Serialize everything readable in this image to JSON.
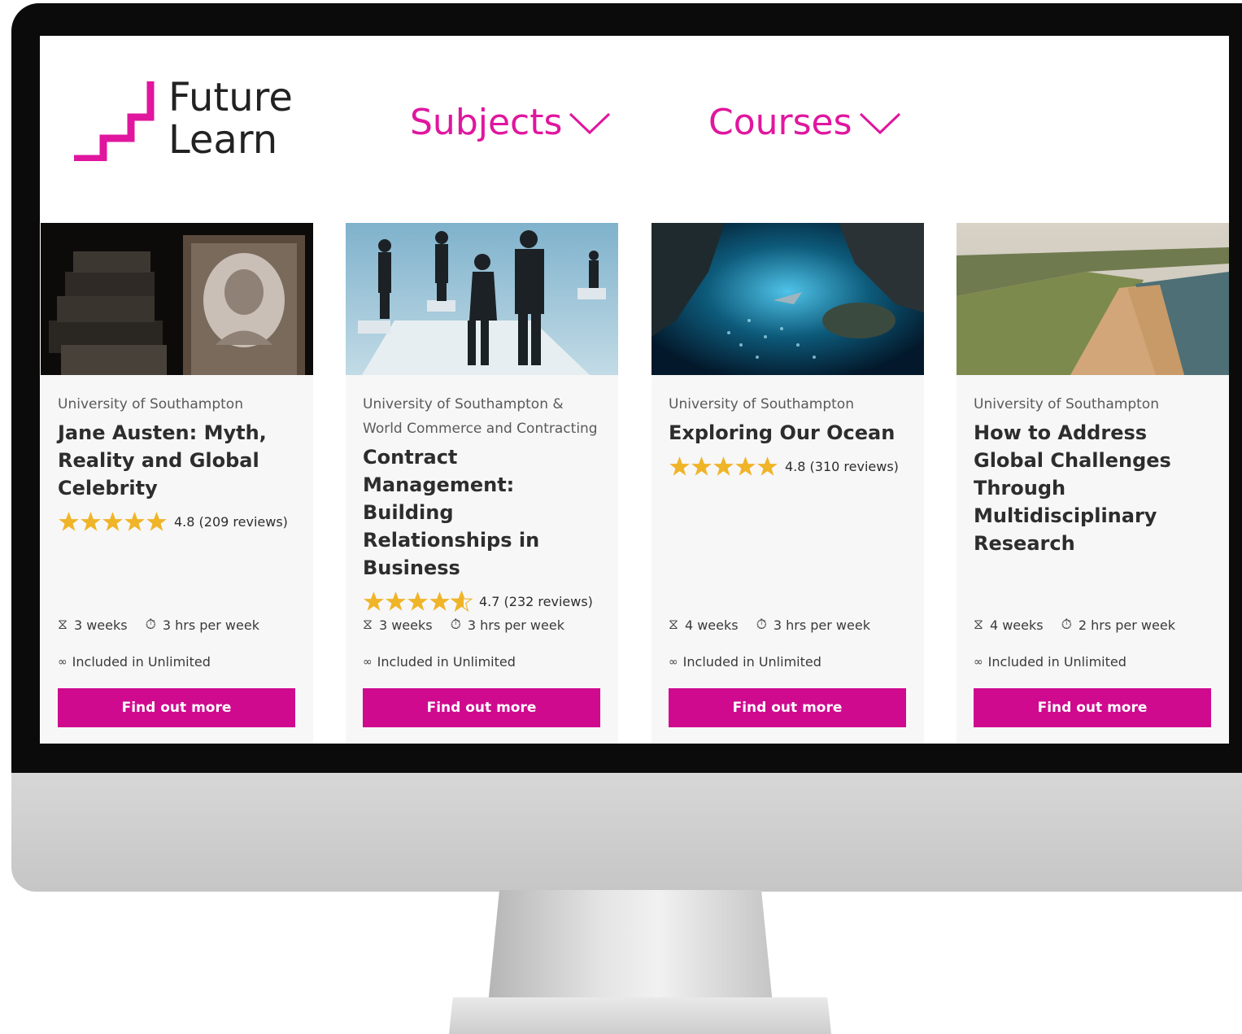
{
  "brand": {
    "line1": "Future",
    "line2": "Learn",
    "accent": "#e0169e"
  },
  "nav": {
    "subjects": "Subjects",
    "courses": "Courses"
  },
  "cards": [
    {
      "provider": "University of Southampton",
      "title": "Jane Austen: Myth, Reality and Global Celebrity",
      "rating": 4.8,
      "rating_text": "4.8 (209 reviews)",
      "duration": "3 weeks",
      "effort": "3 hrs per week",
      "unlimited": "Included in Unlimited",
      "cta": "Find out more",
      "image": "jane-austen-portrait-books"
    },
    {
      "provider": "University of Southampton & World Commerce and Contracting",
      "title": "Contract Management: Building Relationships in Business",
      "rating": 4.7,
      "rating_text": "4.7 (232 reviews)",
      "duration": "3 weeks",
      "effort": "3 hrs per week",
      "unlimited": "Included in Unlimited",
      "cta": "Find out more",
      "image": "business-handshake-puzzle"
    },
    {
      "provider": "University of Southampton",
      "title": "Exploring Our Ocean",
      "rating": 4.8,
      "rating_text": "4.8 (310 reviews)",
      "duration": "4 weeks",
      "effort": "3 hrs per week",
      "unlimited": "Included in Unlimited",
      "cta": "Find out more",
      "image": "underwater-fish-cave"
    },
    {
      "provider": "University of Southampton",
      "title": "How to Address Global Challenges Through Multidisciplinary Research",
      "rating": null,
      "rating_text": "",
      "duration": "4 weeks",
      "effort": "2 hrs per week",
      "unlimited": "Included in Unlimited",
      "cta": "Find out more",
      "image": "lakeshore-aerial"
    }
  ],
  "colors": {
    "cta": "#cf0a8f",
    "star": "#f0b428",
    "title": "#2d2d2d"
  }
}
